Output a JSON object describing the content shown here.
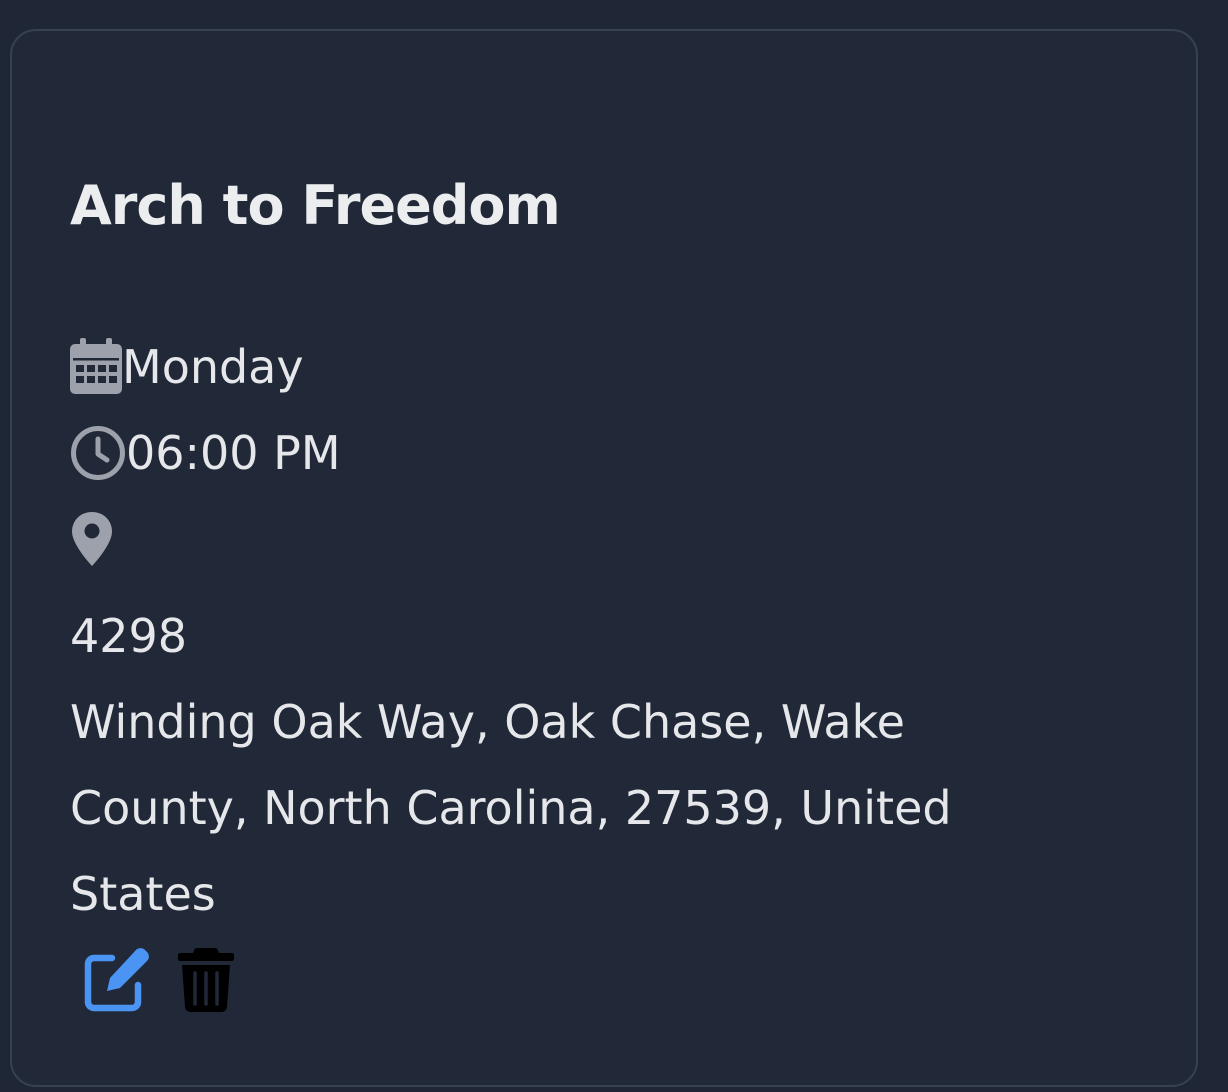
{
  "event": {
    "title": "Arch to Freedom",
    "day": "Monday",
    "time": "06:00 PM",
    "address_lines": [
      "4298",
      "Winding Oak Way, Oak Chase, Wake",
      "County, North Carolina, 27539, United",
      "States"
    ]
  },
  "icons": {
    "day": "calendar-icon",
    "time": "clock-icon",
    "location": "map-pin-icon",
    "edit": "edit-icon",
    "delete": "trash-icon"
  },
  "colors": {
    "background": "#1f2736",
    "card": "#212938",
    "card_border": "#384152",
    "text": "#e6e7ea",
    "icon_muted": "#9ca1ab",
    "edit_accent": "#4c94f4",
    "delete_icon": "#000000"
  }
}
